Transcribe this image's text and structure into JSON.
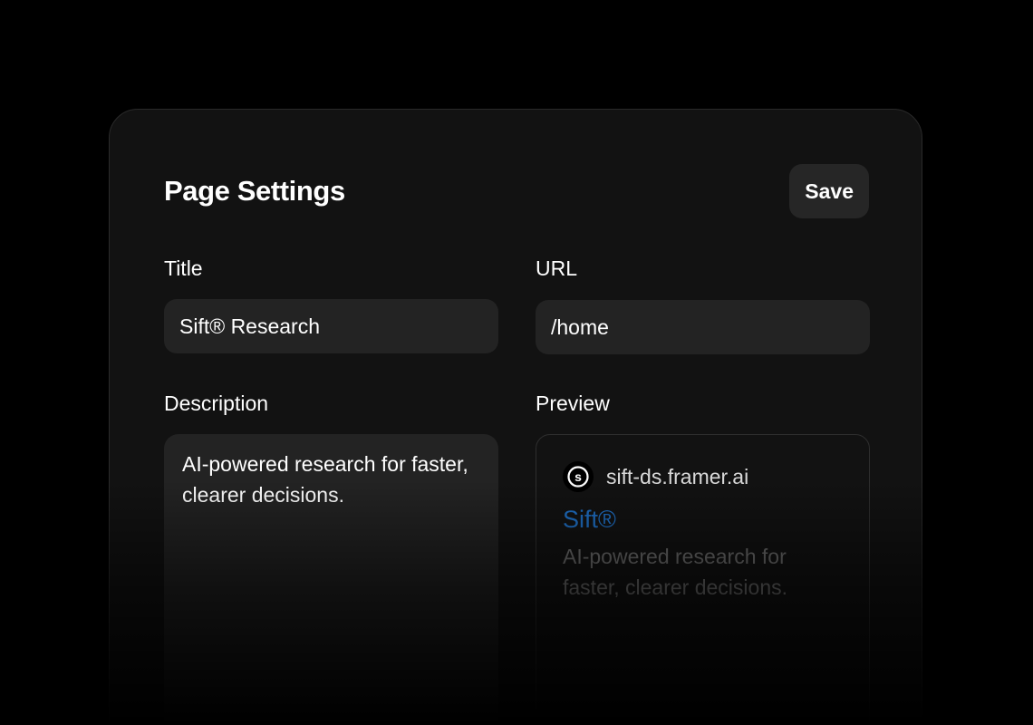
{
  "settings": {
    "title": "Page Settings",
    "save_label": "Save"
  },
  "fields": {
    "title": {
      "label": "Title",
      "value": "Sift® Research"
    },
    "url": {
      "label": "URL",
      "value": "/home"
    },
    "description": {
      "label": "Description",
      "value": "AI-powered research for faster, clearer decisions."
    },
    "preview": {
      "label": "Preview",
      "site_icon": "s-circle-logo-icon",
      "site_url": "sift-ds.framer.ai",
      "page_title": "Sift®",
      "page_description": "AI-powered research for faster, clearer decisions."
    }
  },
  "colors": {
    "background": "#000000",
    "panel": "#121212",
    "input": "#232323",
    "link_title": "#1f6fc4",
    "muted_text": "#6e6e6e"
  }
}
